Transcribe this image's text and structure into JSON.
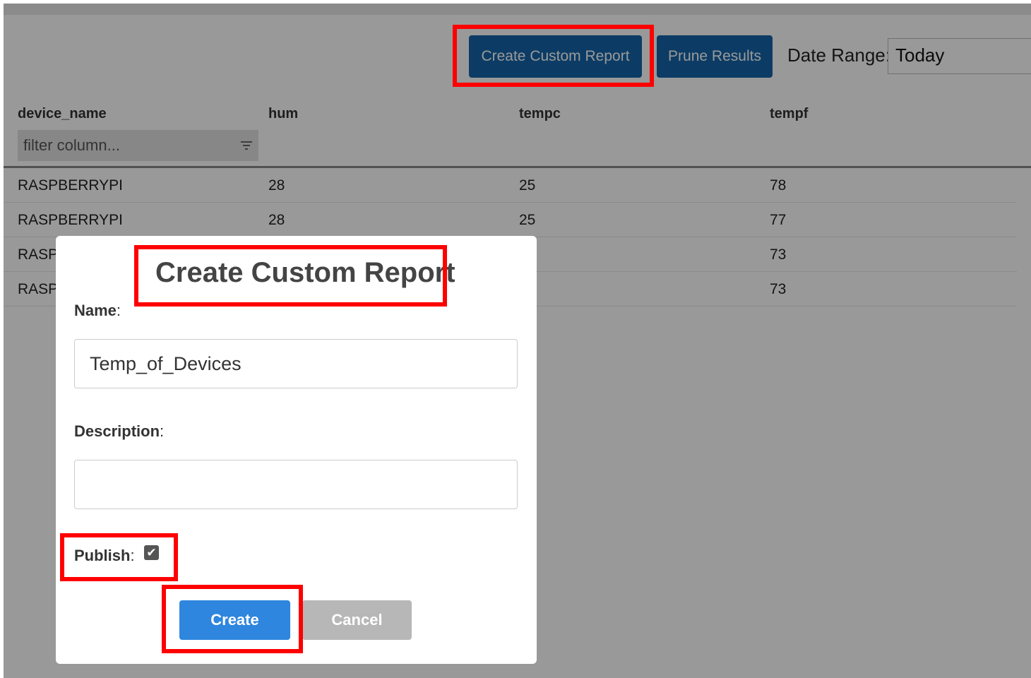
{
  "toolbar": {
    "create_custom_report_label": "Create Custom Report",
    "prune_results_label": "Prune Results",
    "date_range_label": "Date Range:",
    "date_range_value": "Today"
  },
  "table": {
    "columns": [
      "device_name",
      "hum",
      "tempc",
      "tempf"
    ],
    "filter_placeholder": "filter column...",
    "rows": [
      [
        "RASPBERRYPI",
        "28",
        "25",
        "78"
      ],
      [
        "RASPBERRYPI",
        "28",
        "25",
        "77"
      ],
      [
        "RASP",
        "",
        "",
        "73"
      ],
      [
        "RASP",
        "",
        "",
        "73"
      ]
    ]
  },
  "modal": {
    "title": "Create Custom Report",
    "name_label": "Name",
    "name_value": "Temp_of_Devices",
    "description_label": "Description",
    "description_value": "",
    "publish_label": "Publish",
    "publish_checked": true,
    "create_label": "Create",
    "cancel_label": "Cancel"
  },
  "colors": {
    "toolbar_button": "#1565a8",
    "create_button": "#2e86de",
    "cancel_button": "#b7b7b7",
    "highlight": "#ff0000"
  }
}
